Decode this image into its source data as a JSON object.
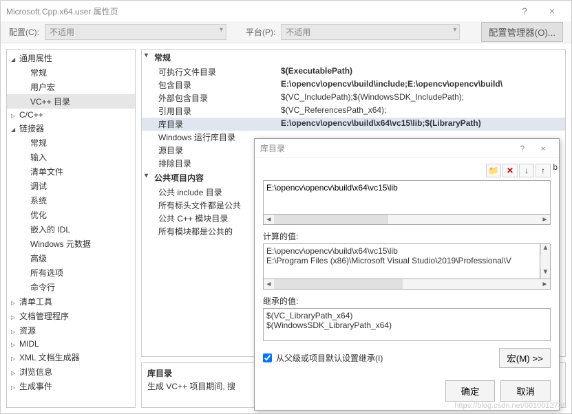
{
  "window": {
    "title": "Microsoft.Cpp.x64.user 属性页",
    "help": "?",
    "close": "×"
  },
  "toolbar": {
    "config_label": "配置(C):",
    "config_value": "不适用",
    "platform_label": "平台(P):",
    "platform_value": "不适用",
    "mgr_button": "配置管理器(O)..."
  },
  "tree": [
    {
      "label": "通用属性",
      "lvl": 1,
      "state": "exp"
    },
    {
      "label": "常规",
      "lvl": 2
    },
    {
      "label": "用户宏",
      "lvl": 2
    },
    {
      "label": "VC++ 目录",
      "lvl": 2,
      "selected": true
    },
    {
      "label": "C/C++",
      "lvl": 1,
      "state": "col"
    },
    {
      "label": "链接器",
      "lvl": 1,
      "state": "exp"
    },
    {
      "label": "常规",
      "lvl": 2
    },
    {
      "label": "输入",
      "lvl": 2
    },
    {
      "label": "清单文件",
      "lvl": 2
    },
    {
      "label": "调试",
      "lvl": 2
    },
    {
      "label": "系统",
      "lvl": 2
    },
    {
      "label": "优化",
      "lvl": 2
    },
    {
      "label": "嵌入的 IDL",
      "lvl": 2
    },
    {
      "label": "Windows 元数据",
      "lvl": 2
    },
    {
      "label": "高级",
      "lvl": 2
    },
    {
      "label": "所有选项",
      "lvl": 2
    },
    {
      "label": "命令行",
      "lvl": 2
    },
    {
      "label": "清单工具",
      "lvl": 1,
      "state": "col"
    },
    {
      "label": "文档管理程序",
      "lvl": 1,
      "state": "col"
    },
    {
      "label": "资源",
      "lvl": 1,
      "state": "col"
    },
    {
      "label": "MIDL",
      "lvl": 1,
      "state": "col"
    },
    {
      "label": "XML 文档生成器",
      "lvl": 1,
      "state": "col"
    },
    {
      "label": "浏览信息",
      "lvl": 1,
      "state": "col"
    },
    {
      "label": "生成事件",
      "lvl": 1,
      "state": "col"
    }
  ],
  "props": {
    "sections": [
      {
        "title": "常规",
        "rows": [
          {
            "key": "可执行文件目录",
            "val": "$(ExecutablePath)",
            "bold": true
          },
          {
            "key": "包含目录",
            "val": "E:\\opencv\\opencv\\build\\include;E:\\opencv\\opencv\\build\\",
            "bold": true
          },
          {
            "key": "外部包含目录",
            "val": "$(VC_IncludePath);$(WindowsSDK_IncludePath);"
          },
          {
            "key": "引用目录",
            "val": "$(VC_ReferencesPath_x64);"
          },
          {
            "key": "库目录",
            "val": "E:\\opencv\\opencv\\build\\x64\\vc15\\lib;$(LibraryPath)",
            "bold": true,
            "sel": true
          },
          {
            "key": "Windows 运行库目录",
            "val": ""
          },
          {
            "key": "源目录",
            "val": ""
          },
          {
            "key": "排除目录",
            "val": ""
          }
        ]
      },
      {
        "title": "公共项目内容",
        "rows": [
          {
            "key": "公共 include 目录",
            "val": ""
          },
          {
            "key": "所有标头文件都是公共",
            "val": ""
          },
          {
            "key": "公共 C++ 模块目录",
            "val": ""
          },
          {
            "key": "所有模块都是公共的",
            "val": ""
          }
        ]
      }
    ]
  },
  "desc": {
    "title": "库目录",
    "text": "生成 VC++ 项目期间, 搜"
  },
  "dialog": {
    "title": "库目录",
    "help": "?",
    "close": "×",
    "icons": {
      "folder": "📁",
      "delete": "✕",
      "down": "↓",
      "up": "↑"
    },
    "edit_value": "E:\\opencv\\opencv\\build\\x64\\vc15\\lib",
    "extra_b": "b",
    "computed_label": "计算的值:",
    "computed_values": "E:\\opencv\\opencv\\build\\x64\\vc15\\lib\nE:\\Program Files (x86)\\Microsoft Visual Studio\\2019\\Professional\\V",
    "inherited_label": "继承的值:",
    "inherited_values": "$(VC_LibraryPath_x64)\n$(WindowsSDK_LibraryPath_x64)",
    "inherit_checkbox": "从父级或项目默认设置继承(I)",
    "inherit_checked": true,
    "macros_button": "宏(M) >>",
    "ok": "确定",
    "cancel": "取消"
  },
  "watermark": "https://blog.csdn.net/0010012738"
}
